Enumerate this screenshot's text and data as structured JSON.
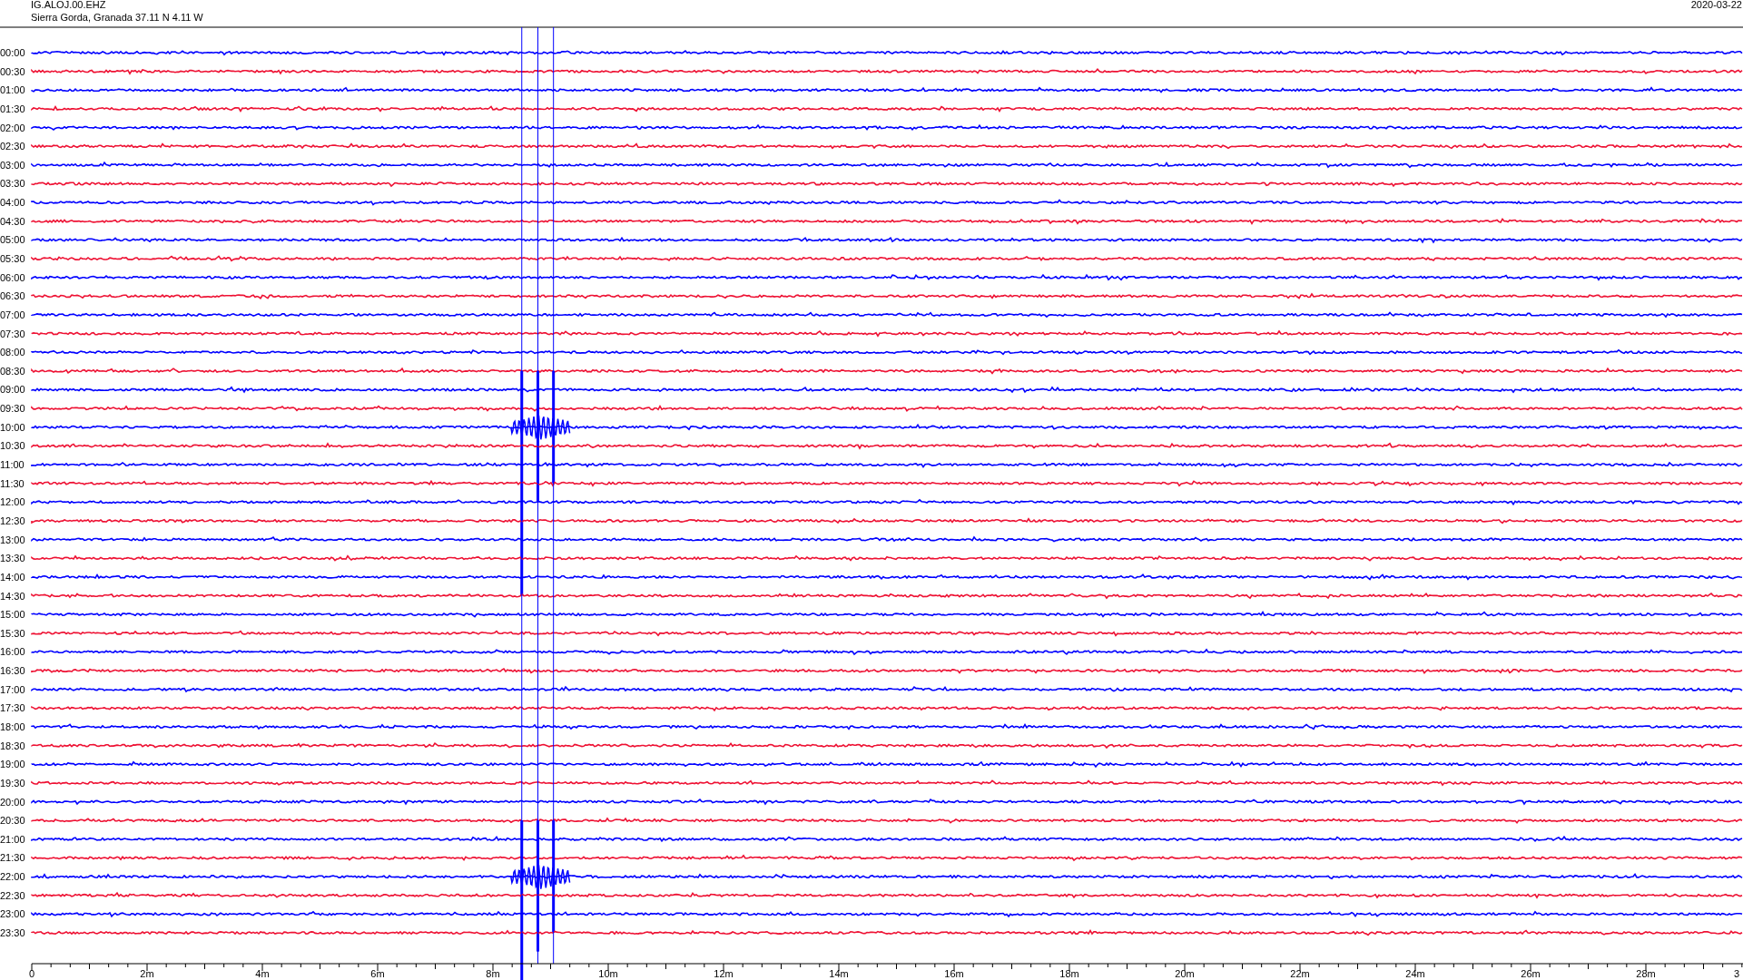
{
  "header": {
    "station": "IG.ALOJ.00.EHZ",
    "location": "Sierra Gorda, Granada  37.11 N 4.11 W",
    "date": "2020-03-22"
  },
  "rows": [
    {
      "time": "00:00",
      "color": "#0000ff",
      "event": false
    },
    {
      "time": "00:30",
      "color": "#ee1133",
      "event": false
    },
    {
      "time": "01:00",
      "color": "#0000ff",
      "event": false
    },
    {
      "time": "01:30",
      "color": "#ee1133",
      "event": false
    },
    {
      "time": "02:00",
      "color": "#0000ff",
      "event": false
    },
    {
      "time": "02:30",
      "color": "#ee1133",
      "event": false
    },
    {
      "time": "03:00",
      "color": "#0000ff",
      "event": false
    },
    {
      "time": "03:30",
      "color": "#ee1133",
      "event": false
    },
    {
      "time": "04:00",
      "color": "#0000ff",
      "event": false
    },
    {
      "time": "04:30",
      "color": "#ee1133",
      "event": false
    },
    {
      "time": "05:00",
      "color": "#0000ff",
      "event": false
    },
    {
      "time": "05:30",
      "color": "#ee1133",
      "event": false
    },
    {
      "time": "06:00",
      "color": "#0000ff",
      "event": false
    },
    {
      "time": "06:30",
      "color": "#ee1133",
      "event": false
    },
    {
      "time": "07:00",
      "color": "#0000ff",
      "event": false
    },
    {
      "time": "07:30",
      "color": "#ee1133",
      "event": false
    },
    {
      "time": "08:00",
      "color": "#0000ff",
      "event": false
    },
    {
      "time": "08:30",
      "color": "#ee1133",
      "event": false
    },
    {
      "time": "09:00",
      "color": "#0000ff",
      "event": false
    },
    {
      "time": "09:30",
      "color": "#ee1133",
      "event": false
    },
    {
      "time": "10:00",
      "color": "#0000ff",
      "event": true
    },
    {
      "time": "10:30",
      "color": "#ee1133",
      "event": false
    },
    {
      "time": "11:00",
      "color": "#0000ff",
      "event": false
    },
    {
      "time": "11:30",
      "color": "#ee1133",
      "event": false
    },
    {
      "time": "12:00",
      "color": "#0000ff",
      "event": false
    },
    {
      "time": "12:30",
      "color": "#ee1133",
      "event": false
    },
    {
      "time": "13:00",
      "color": "#0000ff",
      "event": false
    },
    {
      "time": "13:30",
      "color": "#ee1133",
      "event": false
    },
    {
      "time": "14:00",
      "color": "#0000ff",
      "event": false
    },
    {
      "time": "14:30",
      "color": "#ee1133",
      "event": false
    },
    {
      "time": "15:00",
      "color": "#0000ff",
      "event": false
    },
    {
      "time": "15:30",
      "color": "#ee1133",
      "event": false
    },
    {
      "time": "16:00",
      "color": "#0000ff",
      "event": false
    },
    {
      "time": "16:30",
      "color": "#ee1133",
      "event": false
    },
    {
      "time": "17:00",
      "color": "#0000ff",
      "event": false
    },
    {
      "time": "17:30",
      "color": "#ee1133",
      "event": false
    },
    {
      "time": "18:00",
      "color": "#0000ff",
      "event": false
    },
    {
      "time": "18:30",
      "color": "#ee1133",
      "event": false
    },
    {
      "time": "19:00",
      "color": "#0000ff",
      "event": false
    },
    {
      "time": "19:30",
      "color": "#ee1133",
      "event": false
    },
    {
      "time": "20:00",
      "color": "#0000ff",
      "event": false
    },
    {
      "time": "20:30",
      "color": "#ee1133",
      "event": false
    },
    {
      "time": "21:00",
      "color": "#0000ff",
      "event": false
    },
    {
      "time": "21:30",
      "color": "#ee1133",
      "event": false
    },
    {
      "time": "22:00",
      "color": "#0000ff",
      "event": true
    },
    {
      "time": "22:30",
      "color": "#ee1133",
      "event": false
    },
    {
      "time": "23:00",
      "color": "#0000ff",
      "event": false
    },
    {
      "time": "23:30",
      "color": "#ee1133",
      "event": false
    }
  ],
  "x_axis_labels": [
    "0",
    "2m",
    "4m",
    "6m",
    "8m",
    "10m",
    "12m",
    "14m",
    "16m",
    "18m",
    "20m",
    "22m",
    "24m",
    "26m",
    "28m",
    "3"
  ]
}
